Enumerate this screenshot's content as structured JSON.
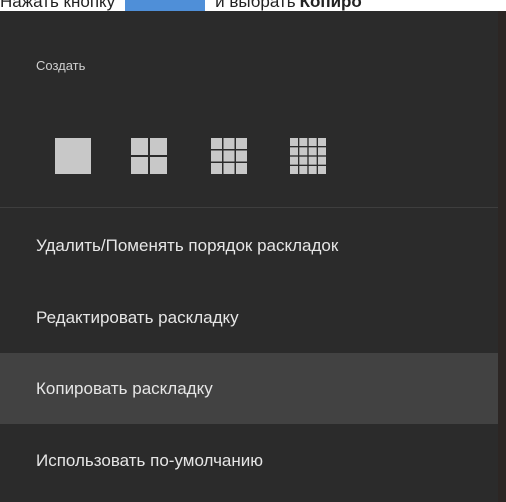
{
  "instruction": {
    "before": "Нажать кнопку",
    "after": "и выбрать",
    "bold": "Копиро"
  },
  "menu": {
    "create_label": "Создать",
    "layout_icons": [
      "layout-1x1-icon",
      "layout-2x2-icon",
      "layout-3x3-icon",
      "layout-4x4-icon"
    ],
    "items": [
      {
        "label": "Удалить/Поменять порядок раскладок",
        "highlighted": false
      },
      {
        "label": "Редактировать раскладку",
        "highlighted": false
      },
      {
        "label": "Копировать раскладку",
        "highlighted": true
      },
      {
        "label": "Использовать по-умолчанию",
        "highlighted": false
      }
    ]
  },
  "colors": {
    "menu_background": "#2b2b2b",
    "highlight": "#424242",
    "text": "#e6e6e6",
    "icon": "#c8c8c8",
    "accent_button": "#4f8fd8"
  }
}
